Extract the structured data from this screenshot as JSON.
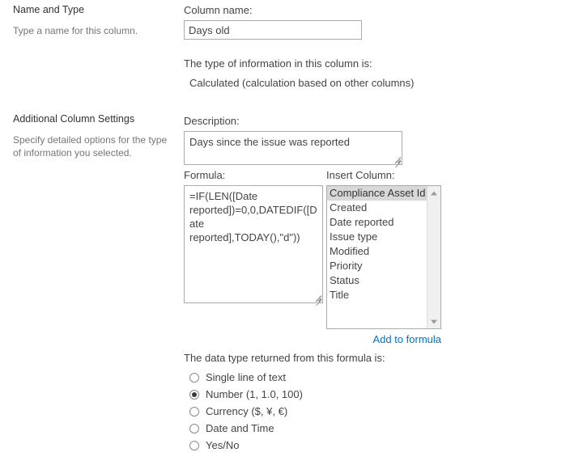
{
  "sections": [
    {
      "title": "Name and Type",
      "description": "Type a name for this column."
    },
    {
      "title": "Additional Column Settings",
      "description": "Specify detailed options for the type of information you selected."
    }
  ],
  "form": {
    "column_name_label": "Column name:",
    "column_name_value": "Days old",
    "column_name_placeholder": "",
    "type_info_label": "The type of information in this column is:",
    "type_info_value": "Calculated (calculation based on other columns)",
    "description_label": "Description:",
    "description_value": "Days since the issue was reported",
    "description_placeholder": "",
    "formula_label": "Formula:",
    "formula_value": "=IF(LEN([Date reported])=0,0,DATEDIF([Date reported],TODAY(),\"d\"))",
    "formula_placeholder": "",
    "insert_column_label": "Insert Column:",
    "insert_column_items": [
      "Compliance Asset Id",
      "Created",
      "Date reported",
      "Issue type",
      "Modified",
      "Priority",
      "Status",
      "Title"
    ],
    "insert_column_selected": "Compliance Asset Id",
    "add_to_formula_label": "Add to formula",
    "data_type_label": "The data type returned from this formula is:",
    "data_type_options": [
      {
        "label": "Single line of text",
        "checked": false
      },
      {
        "label": "Number (1, 1.0, 100)",
        "checked": true
      },
      {
        "label": "Currency ($, ¥, €)",
        "checked": false
      },
      {
        "label": "Date and Time",
        "checked": false
      },
      {
        "label": "Yes/No",
        "checked": false
      }
    ]
  },
  "icons": {
    "scroll_up": "scroll-up-arrow-icon",
    "scroll_down": "scroll-down-arrow-icon",
    "resize_grip": "resize-grip-icon"
  },
  "colors": {
    "link": "#0072c6",
    "selection": "#d8d8d8",
    "border": "#ababab"
  }
}
